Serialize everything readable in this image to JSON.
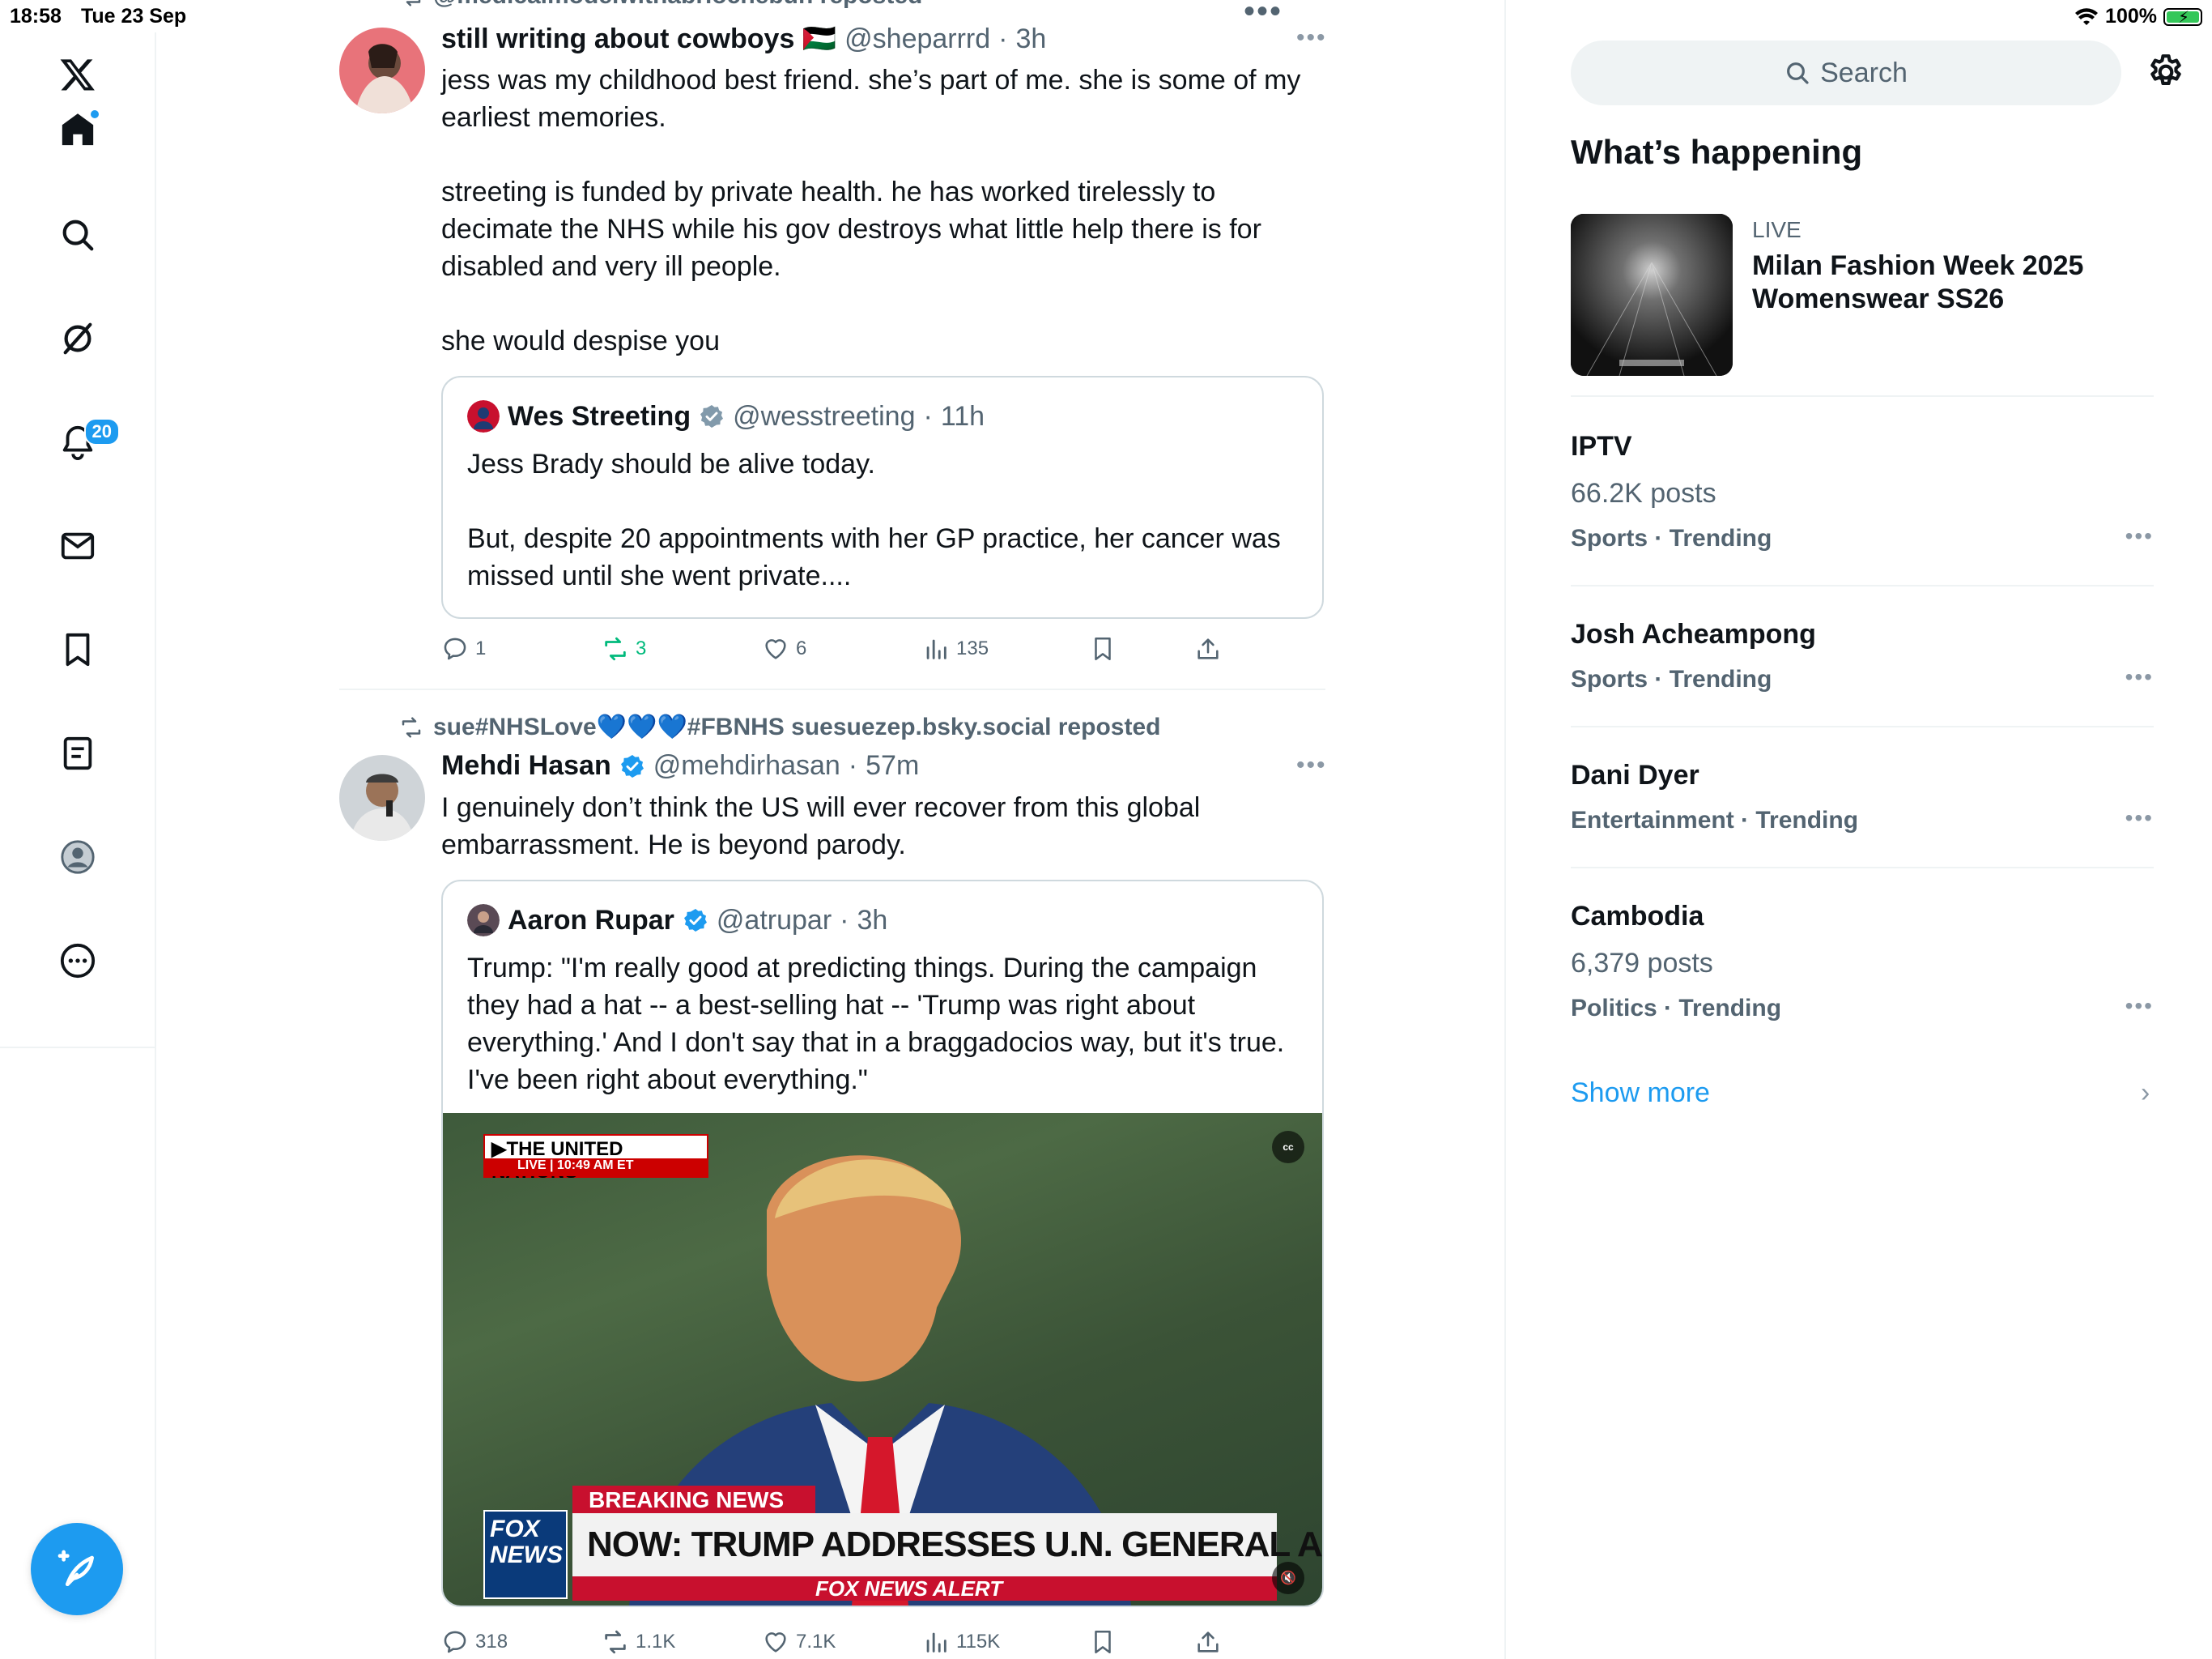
{
  "status_bar": {
    "time": "18:58",
    "date": "Tue 23 Sep",
    "battery": "100%"
  },
  "nav": {
    "notifications_badge": "20",
    "items": [
      "x-logo",
      "home",
      "explore",
      "grok",
      "notifications",
      "messages",
      "bookmarks",
      "lists",
      "profile",
      "more"
    ]
  },
  "timeline": {
    "tweets": [
      {
        "repost_by": "@medicalmodelwithabriochebun reposted",
        "name": "still writing about cowboys 🇵🇸",
        "handle": "@sheparrrd",
        "sep": "·",
        "time": "3h",
        "text": "jess was my childhood best friend. she’s part of me. she is some of my\nearliest memories.\n\nstreeting is funded by private health. he has worked tirelessly to\ndecimate the NHS while his gov destroys what little help there is for\ndisabled and very ill people.\n\nshe would despise you",
        "quote": {
          "name": "Wes Streeting",
          "handle": "@wesstreeting",
          "sep": "·",
          "time": "11h",
          "text": "Jess Brady should be alive today.\n\nBut, despite 20 appointments with her GP practice, her cancer was\nmissed until she went private...."
        },
        "actions": {
          "replies": "1",
          "reposts": "3",
          "likes": "6",
          "views": "135"
        }
      },
      {
        "repost_by": "sue#NHSLove💙💙💙#FBNHS suesuezep.bsky.social reposted",
        "name": "Mehdi Hasan",
        "handle": "@mehdirhasan",
        "sep": "·",
        "time": "57m",
        "text": "I genuinely don’t think the US will ever recover from this global\nembarrassment. He is beyond parody.",
        "quote": {
          "name": "Aaron Rupar",
          "handle": "@atrupar",
          "sep": "·",
          "time": "3h",
          "text": "Trump: \"I'm really good at predicting things. During the campaign\nthey had a hat -- a best-selling hat -- 'Trump was right about\neverything.' And I don't say that in a braggadocios way, but it's true.\nI've been right about everything.\"",
          "video": {
            "banner_top": "▶THE UNITED NATIONS",
            "banner_live": "LIVE  |  10:49 AM ET",
            "cc": "cc",
            "breaking": "BREAKING NEWS",
            "headline": "NOW: TRUMP ADDRESSES U.N. GENERAL ASSEMBLY",
            "alert": "FOX NEWS ALERT",
            "logo": "FOX NEWS"
          }
        },
        "actions": {
          "replies": "318",
          "reposts": "1.1K",
          "likes": "7.1K",
          "views": "115K"
        }
      }
    ]
  },
  "sidebar": {
    "search_placeholder": "Search",
    "section_title": "What’s happening",
    "featured": {
      "label": "LIVE",
      "title": "Milan Fashion Week 2025 Womenswear SS26"
    },
    "trends": [
      {
        "name": "IPTV",
        "posts": "66.2K posts",
        "category": "Sports · Trending"
      },
      {
        "name": "Josh Acheampong",
        "posts": "",
        "category": "Sports · Trending"
      },
      {
        "name": "Dani Dyer",
        "posts": "",
        "category": "Entertainment · Trending"
      },
      {
        "name": "Cambodia",
        "posts": "6,379 posts",
        "category": "Politics · Trending"
      }
    ],
    "show_more": "Show more"
  },
  "colors": {
    "accent": "#1d9bf0",
    "repost_green": "#00ba7c",
    "secondary_text": "#536471"
  }
}
